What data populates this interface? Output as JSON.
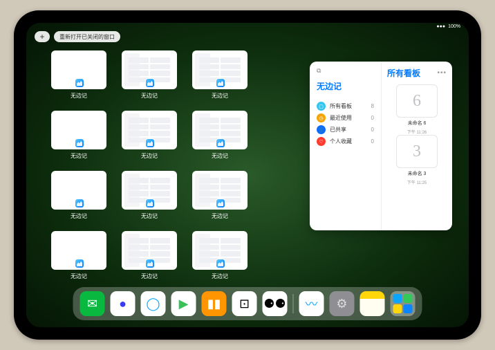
{
  "status": {
    "battery": "100%",
    "wifi": "●●●"
  },
  "top": {
    "plus": "+",
    "reopen": "重新打开已关闭的窗口"
  },
  "app_name": "无边记",
  "windows": [
    {
      "label": "无边记",
      "variant": "blank"
    },
    {
      "label": "无边记",
      "variant": "split"
    },
    {
      "label": "无边记",
      "variant": "split"
    },
    {
      "label": "无边记",
      "variant": "blank"
    },
    {
      "label": "无边记",
      "variant": "split"
    },
    {
      "label": "无边记",
      "variant": "split"
    },
    {
      "label": "无边记",
      "variant": "blank"
    },
    {
      "label": "无边记",
      "variant": "split"
    },
    {
      "label": "无边记",
      "variant": "split"
    },
    {
      "label": "无边记",
      "variant": "blank"
    },
    {
      "label": "无边记",
      "variant": "split"
    },
    {
      "label": "无边记",
      "variant": "split"
    }
  ],
  "panel": {
    "sidebar_icon": "⧉",
    "title": "无边记",
    "items": [
      {
        "icon_color": "#34c5f1",
        "glyph": "▢",
        "label": "所有看板",
        "count": "8"
      },
      {
        "icon_color": "#f7a500",
        "glyph": "◷",
        "label": "最近使用",
        "count": "0"
      },
      {
        "icon_color": "#0d6cff",
        "glyph": "👤",
        "label": "已共享",
        "count": "0"
      },
      {
        "icon_color": "#ff3b30",
        "glyph": "♡",
        "label": "个人收藏",
        "count": "0"
      }
    ]
  },
  "right": {
    "title": "所有看板",
    "more": "•••",
    "boards": [
      {
        "glyph": "6",
        "label": "未命名 6",
        "time": "下午 11:26"
      },
      {
        "glyph": "3",
        "label": "未命名 3",
        "time": "下午 11:25"
      }
    ]
  },
  "dock": {
    "apps": [
      {
        "name": "wechat",
        "bg": "#09b83e",
        "fg": "#fff",
        "glyph": "✉"
      },
      {
        "name": "quark",
        "bg": "#fff",
        "fg": "#3a3af0",
        "glyph": "●"
      },
      {
        "name": "qqbrowser",
        "bg": "#fff",
        "fg": "#0aa5ff",
        "glyph": "◯"
      },
      {
        "name": "play",
        "bg": "#fff",
        "fg": "#3ac159",
        "glyph": "▶"
      },
      {
        "name": "books",
        "bg": "#ff9500",
        "fg": "#fff",
        "glyph": "▮▮"
      },
      {
        "name": "dice",
        "bg": "#fff",
        "fg": "#000",
        "glyph": "⊡"
      },
      {
        "name": "shapes",
        "bg": "#fff",
        "fg": "#000",
        "glyph": "⚈⚈"
      },
      {
        "name": "freeform",
        "bg": "#fff",
        "fg": "#0aa5ff",
        "glyph": "〰"
      },
      {
        "name": "settings",
        "bg": "#8e8e93",
        "fg": "#ddd",
        "glyph": "⚙"
      },
      {
        "name": "notes",
        "bg": "linear-gradient(#ffd60a 30%, #fffef0 30%)",
        "fg": "#333",
        "glyph": ""
      }
    ],
    "folder": [
      "#0aa5ff",
      "#34c759",
      "#ffd60a",
      "#0a84ff"
    ]
  }
}
